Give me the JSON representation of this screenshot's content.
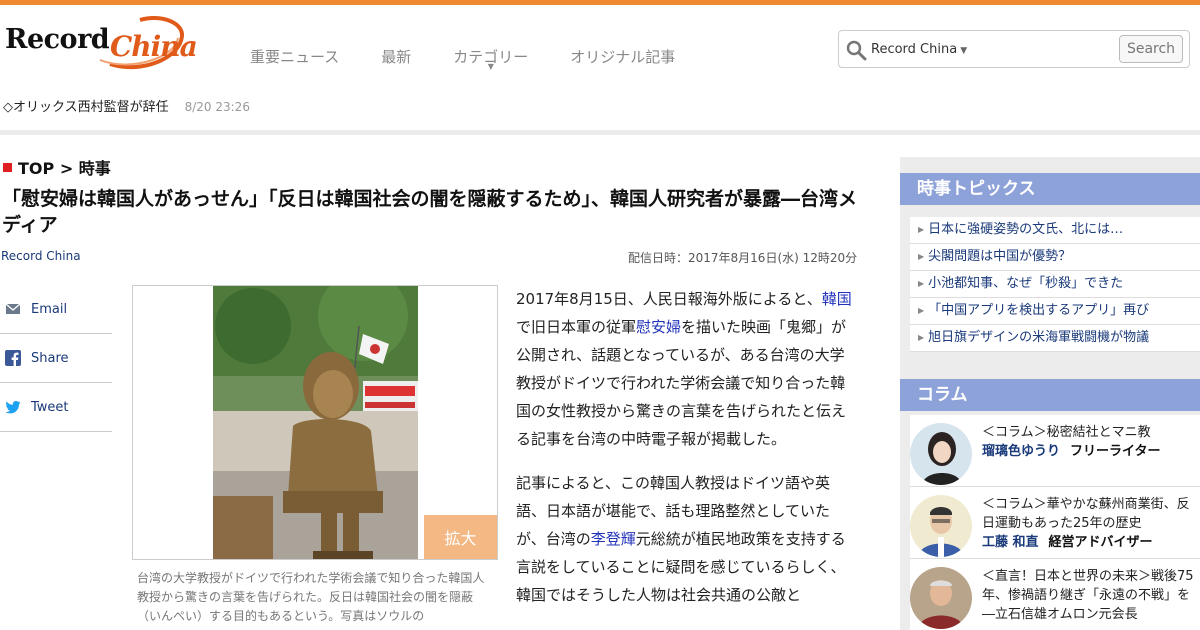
{
  "colors": {
    "accent": "#f08a30",
    "link": "#2233bb",
    "sidebar_head": "#8ea2da"
  },
  "header": {
    "logo_record": "Record",
    "logo_china": "China",
    "nav": [
      {
        "label": "重要ニュース"
      },
      {
        "label": "最新"
      },
      {
        "label": "カテゴリー"
      },
      {
        "label": "オリジナル記事"
      }
    ],
    "search": {
      "scope": "Record China",
      "button": "Search",
      "placeholder": ""
    }
  },
  "ticker": {
    "text": "◇オリックス西村監督が辞任",
    "time": "8/20 23:26"
  },
  "article": {
    "breadcrumb_top": "TOP",
    "breadcrumb_sep": " > ",
    "breadcrumb_cat": "時事",
    "headline": "「慰安婦は韓国人があっせん」「反日は韓国社会の闇を隠蔽するため」、韓国人研究者が暴露―台湾メディア",
    "source": "Record China",
    "pubdate": "配信日時：2017年8月16日(水) 12時20分",
    "share": [
      {
        "label": "Email",
        "icon": "mail-icon"
      },
      {
        "label": "Share",
        "icon": "facebook-icon"
      },
      {
        "label": "Tweet",
        "icon": "twitter-icon"
      }
    ],
    "zoom_label": "拡大",
    "caption": "台湾の大学教授がドイツで行われた学術会議で知り合った韓国人教授から驚きの言葉を告げられた。反日は韓国社会の闇を隠蔽（いんぺい）する目的もあるという。写真はソウルの",
    "p1_a": "2017年8月15日、人民日報海外版によると、",
    "p1_link1": "韓国",
    "p1_b": "で旧日本軍の従軍",
    "p1_link2": "慰安婦",
    "p1_c": "を描いた映画「鬼郷」が公開され、話題となっているが、ある台湾の大学教授がドイツで行われた学術会議で知り合った韓国の女性教授から驚きの言葉を告げられたと伝える記事を台湾の中時電子報が掲載した。",
    "p2_a": "記事によると、この韓国人教授はドイツ語や英語、日本語が堪能で、話も理路整然としていたが、台湾の",
    "p2_link": "李登輝",
    "p2_b": "元総統が植民地政策を支持する言説をしていることに疑問を感じているらしく、韓国ではそうした人物は社会共通の公敵と"
  },
  "sidebar": {
    "topics_title": "時事トピックス",
    "topics": [
      "日本に強硬姿勢の文氏、北には…",
      "尖閣問題は中国が優勢？",
      "小池都知事、なぜ「秒殺」できた",
      "「中国アプリを検出するアプリ」再び",
      "旭日旗デザインの米海軍戦闘機が物議"
    ],
    "columns_title": "コラム",
    "columns": [
      {
        "title": "＜コラム＞秘密結社とマニ教",
        "author": "瑠璃色ゆうり",
        "role": "フリーライター"
      },
      {
        "title": "＜コラム＞華やかな蘇州商業街、反日運動もあった25年の歴史",
        "author": "工藤 和直",
        "role": "経営アドバイザー"
      },
      {
        "title": "＜直言！日本と世界の未来＞戦後75年、惨禍語り継ぎ「永遠の不戦」を―立石信雄オムロン元会長",
        "author": "",
        "role": ""
      }
    ]
  }
}
